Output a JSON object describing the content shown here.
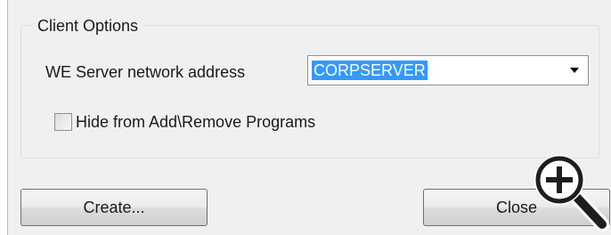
{
  "dialog": {
    "group_title": "Client Options",
    "server_label": "WE Server network address",
    "server_value": "CORPSERVER",
    "hide_label": "Hide from Add\\Remove Programs",
    "hide_checked": false,
    "create_label": "Create...",
    "close_label": "Close"
  },
  "icons": {
    "combo_arrow": "chevron-down-icon",
    "zoom": "zoom-in-icon"
  }
}
